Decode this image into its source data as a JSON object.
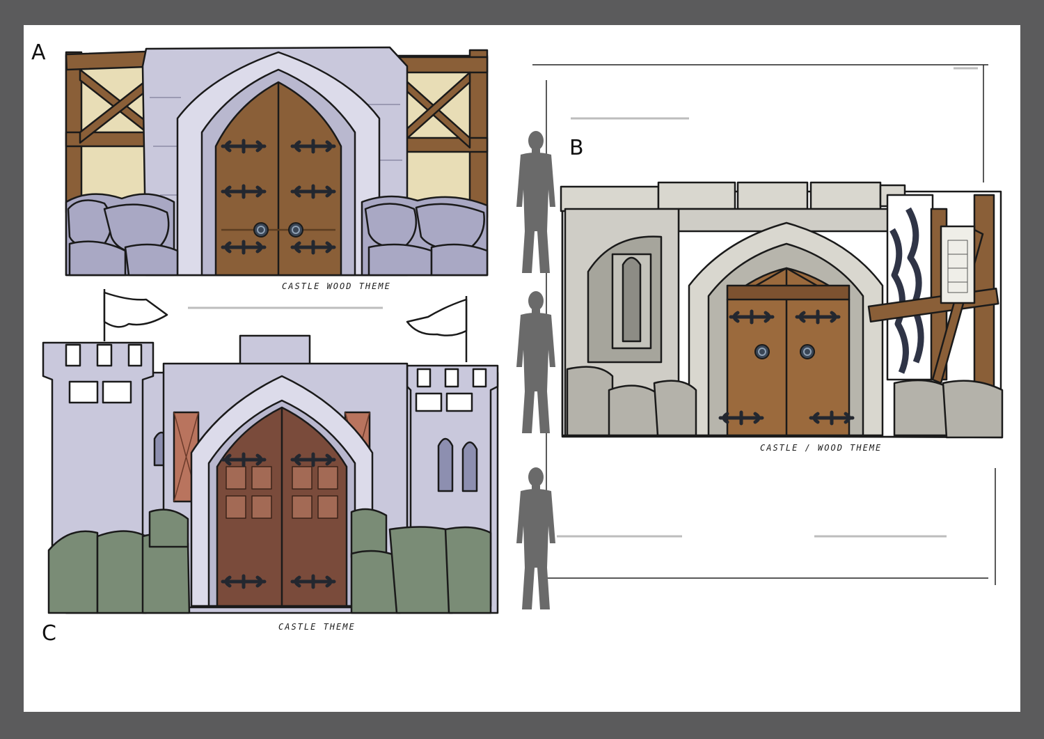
{
  "sketches": {
    "a": {
      "letter": "A",
      "caption": "CASTLE WOOD THEME"
    },
    "b": {
      "letter": "B",
      "caption": "CASTLE / WOOD THEME"
    },
    "c": {
      "letter": "C",
      "caption": "CASTLE THEME"
    }
  },
  "icons": [
    "person-silhouette-icon",
    "flag-icon",
    "door-knocker-icon",
    "door-hinge-icon"
  ],
  "colors": {
    "frame": "#5b5b5c",
    "paper": "#ffffff",
    "stone_lavender": "#c9c8dc",
    "stone_gray": "#cfcdc6",
    "wood": "#8a5f38",
    "door_red": "#7a4b3b",
    "moss": "#7a8c76",
    "silhouette": "#6a6a6a"
  }
}
